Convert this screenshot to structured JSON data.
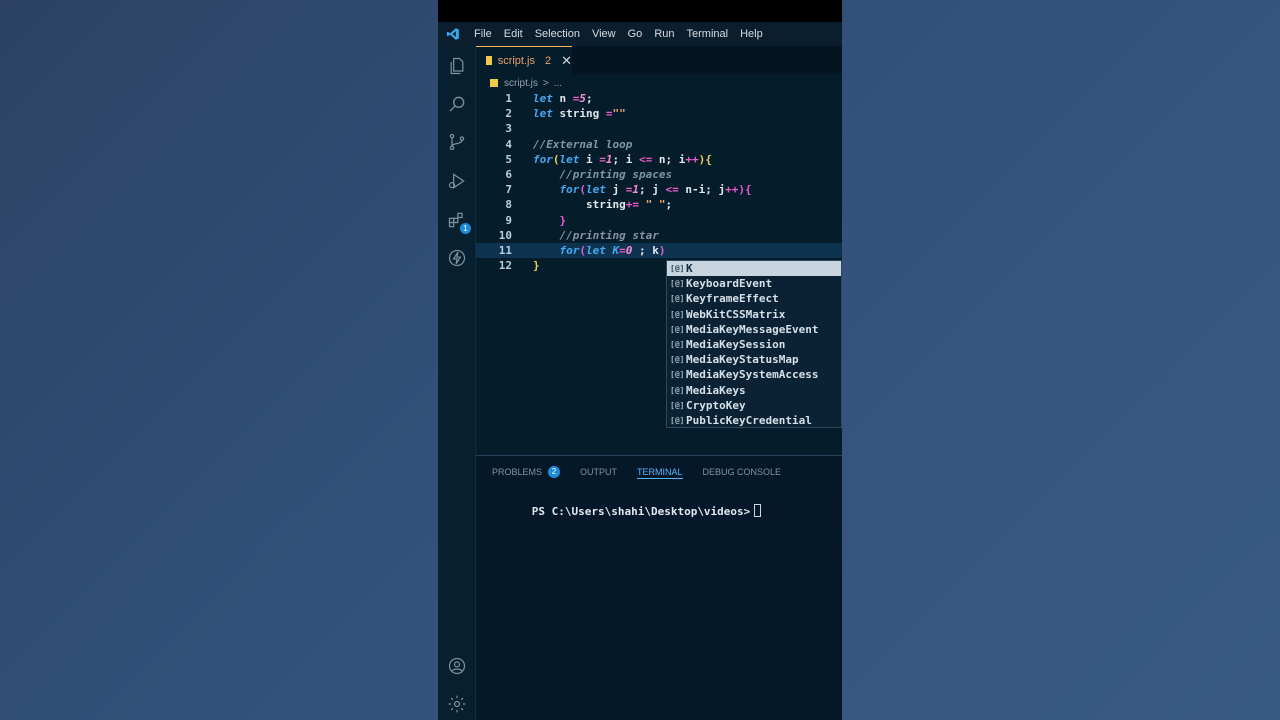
{
  "menubar": {
    "items": [
      "File",
      "Edit",
      "Selection",
      "View",
      "Go",
      "Run",
      "Terminal",
      "Help"
    ]
  },
  "tab": {
    "name": "script.js",
    "problem_count": "2",
    "close": "✕"
  },
  "breadcrumb": {
    "file": "script.js",
    "separator": ">",
    "symbol": "..."
  },
  "editor": {
    "line_numbers": [
      "1",
      "2",
      "3",
      "4",
      "5",
      "6",
      "7",
      "8",
      "9",
      "10",
      "11",
      "12"
    ],
    "lines": [
      [
        {
          "t": "let",
          "c": "kw"
        },
        {
          "t": " n ",
          "c": ""
        },
        {
          "t": "=",
          "c": "op"
        },
        {
          "t": "5",
          "c": "nm"
        },
        {
          "t": ";",
          "c": ""
        }
      ],
      [
        {
          "t": "let",
          "c": "kw"
        },
        {
          "t": " string ",
          "c": ""
        },
        {
          "t": "=",
          "c": "op"
        },
        {
          "t": "\"\"",
          "c": "st"
        }
      ],
      [],
      [
        {
          "t": "//External loop",
          "c": "cm"
        }
      ],
      [
        {
          "t": "for",
          "c": "kw"
        },
        {
          "t": "(",
          "c": "br1"
        },
        {
          "t": "let",
          "c": "kw"
        },
        {
          "t": " i ",
          "c": ""
        },
        {
          "t": "=",
          "c": "op"
        },
        {
          "t": "1",
          "c": "nm"
        },
        {
          "t": "; i ",
          "c": ""
        },
        {
          "t": "<=",
          "c": "op"
        },
        {
          "t": " n; i",
          "c": ""
        },
        {
          "t": "++",
          "c": "op"
        },
        {
          "t": ")",
          "c": "br1"
        },
        {
          "t": "{",
          "c": "br1"
        }
      ],
      [
        {
          "t": "    ",
          "c": ""
        },
        {
          "t": "//printing spaces",
          "c": "cm"
        }
      ],
      [
        {
          "t": "    ",
          "c": ""
        },
        {
          "t": "for",
          "c": "kw"
        },
        {
          "t": "(",
          "c": "br2"
        },
        {
          "t": "let",
          "c": "kw"
        },
        {
          "t": " j ",
          "c": ""
        },
        {
          "t": "=",
          "c": "op"
        },
        {
          "t": "1",
          "c": "nm"
        },
        {
          "t": "; j ",
          "c": ""
        },
        {
          "t": "<=",
          "c": "op"
        },
        {
          "t": " n-i; j",
          "c": ""
        },
        {
          "t": "++",
          "c": "op"
        },
        {
          "t": ")",
          "c": "br2"
        },
        {
          "t": "{",
          "c": "br2"
        }
      ],
      [
        {
          "t": "        string",
          "c": ""
        },
        {
          "t": "+=",
          "c": "op"
        },
        {
          "t": " ",
          "c": ""
        },
        {
          "t": "\" \"",
          "c": "st"
        },
        {
          "t": ";",
          "c": ""
        }
      ],
      [
        {
          "t": "    ",
          "c": ""
        },
        {
          "t": "}",
          "c": "br2"
        }
      ],
      [
        {
          "t": "    ",
          "c": ""
        },
        {
          "t": "//printing star",
          "c": "cm"
        }
      ],
      [
        {
          "t": "    ",
          "c": ""
        },
        {
          "t": "for",
          "c": "kw"
        },
        {
          "t": "(",
          "c": "br2"
        },
        {
          "t": "let",
          "c": "kw"
        },
        {
          "t": " ",
          "c": ""
        },
        {
          "t": "K",
          "c": "kw"
        },
        {
          "t": "=",
          "c": "op"
        },
        {
          "t": "0",
          "c": "nm"
        },
        {
          "t": " ; k",
          "c": ""
        },
        {
          "t": ")",
          "c": "br2"
        }
      ],
      [
        {
          "t": "}",
          "c": "br1"
        }
      ]
    ],
    "current_line_index": 10
  },
  "suggest": {
    "icon": "[@]",
    "items": [
      "K",
      "KeyboardEvent",
      "KeyframeEffect",
      "WebKitCSSMatrix",
      "MediaKeyMessageEvent",
      "MediaKeySession",
      "MediaKeyStatusMap",
      "MediaKeySystemAccess",
      "MediaKeys",
      "CryptoKey",
      "PublicKeyCredential"
    ],
    "selected_index": 0
  },
  "panel": {
    "tabs": [
      "PROBLEMS",
      "OUTPUT",
      "TERMINAL",
      "DEBUG CONSOLE"
    ],
    "problems_badge": "2",
    "active_tab": "TERMINAL",
    "terminal_prompt": "PS C:\\Users\\shahi\\Desktop\\videos>"
  },
  "colors": {
    "editor_bg": "#051c2a",
    "accent": "#58b3ff",
    "keyword": "#45a9f2",
    "string": "#f5a86a"
  }
}
